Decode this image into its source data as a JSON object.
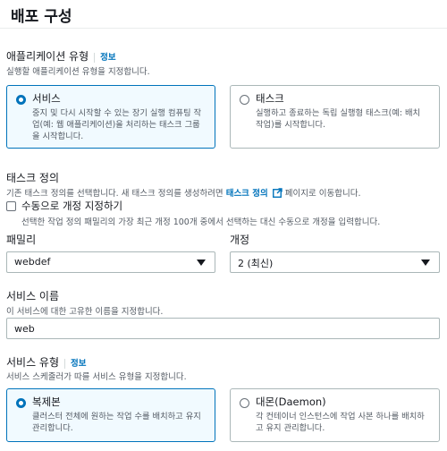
{
  "page": {
    "title": "배포 구성"
  },
  "app_type": {
    "label": "애플리케이션 유형",
    "info": "정보",
    "description": "실행할 애플리케이션 유형을 지정합니다.",
    "options": [
      {
        "title": "서비스",
        "description": "중지 및 다시 시작할 수 있는 장기 실행 컴퓨팅 작업(예: 웹 애플리케이션)을 처리하는 태스크 그룹을 시작합니다.",
        "selected": true
      },
      {
        "title": "태스크",
        "description": "실행하고 종료하는 독립 실행형 태스크(예: 배치 작업)를 시작합니다.",
        "selected": false
      }
    ]
  },
  "task_def": {
    "label": "태스크 정의",
    "description_prefix": "기존 태스크 정의를 선택합니다. 새 태스크 정의를 생성하려면",
    "link_text": "태스크 정의",
    "description_suffix": "페이지로 이동합니다.",
    "manual_revision_label": "수동으로 개정 지정하기",
    "manual_revision_description": "선택한 작업 정의 패밀리의 가장 최근 개정 100개 중에서 선택하는 대신 수동으로 개정을 입력합니다.",
    "family_label": "패밀리",
    "family_value": "webdef",
    "revision_label": "개정",
    "revision_value": "2 (최신)"
  },
  "service_name": {
    "label": "서비스 이름",
    "description": "이 서비스에 대한 고유한 이름을 지정합니다.",
    "value": "web"
  },
  "service_type": {
    "label": "서비스 유형",
    "info": "정보",
    "description": "서비스 스케줄러가 따를 서비스 유형을 지정합니다.",
    "options": [
      {
        "title": "복제본",
        "description": "클러스터 전체에 원하는 작업 수를 배치하고 유지 관리합니다.",
        "selected": true
      },
      {
        "title": "대몬(Daemon)",
        "description": "각 컨테이너 인스턴스에 작업 사본 하나를 배치하고 유지 관리합니다.",
        "selected": false
      }
    ]
  }
}
